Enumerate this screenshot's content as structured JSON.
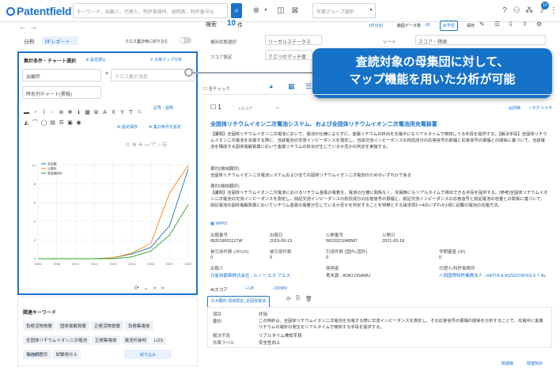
{
  "header": {
    "logo": "Patentfield",
    "search_placeholder": "キーワード、出願人、代理人、特許事務所、発明者、特許番号な",
    "group_placeholder": "作業グループ選択",
    "notification_count": "10"
  },
  "subbar": {
    "analysis_label": "分析",
    "report_button": "PFレポート",
    "cross_filter_label": "クロス集計時に絞り込む",
    "search_label": "検索",
    "result_count": "10",
    "result_unit": "件",
    "view_count": "1件分割",
    "data_count": "範囲データ数",
    "data_value": "60",
    "ai_label": "AI予見",
    "save_label": "保存"
  },
  "left_panel": {
    "section_title": "集計条件・チャート選択",
    "settings_link": "設定読込",
    "map_analysis": "引用マップ分析",
    "field_value": "出願年",
    "cross_placeholder": "クロス集計項目",
    "chart_select": "時系列チャート(累積)",
    "chart_label_link": "記号・説明",
    "save_settings": "設定保存",
    "chart_settings": "集計条件を設定",
    "legend": [
      "全出願",
      "公開件",
      "登録権利件"
    ],
    "more_label": "more »",
    "filter_button": "絞り込み"
  },
  "related_keywords": {
    "title": "関連キーワード",
    "items": [
      "負極活物質層",
      "固体電解質層",
      "正極活物質層",
      "負極集電体",
      "全固体リチウムイオン二次電池",
      "正極集電体",
      "電池外装材",
      "Li2S",
      "電池調整形",
      "試験用セル"
    ]
  },
  "right_panel": {
    "filter_label_1": "権利状態選択",
    "filter_value_1": "リーガルステータス",
    "sort_label": "ソート",
    "sort_value": "スコア・降順",
    "score_label": "スコア設定",
    "score_value": "クエリのマッチ度",
    "all_check": "全チェック",
    "record_index": "1",
    "score_text": "スコア",
    "action_eval": "評価",
    "action_tag": "タグ",
    "action_memo": "メモ",
    "title": "全固体リチウムイオン二次電池システム、および全固体リチウムイオン二次電池用充電装置",
    "abstract": "【課題】全固体リチウムイオン二次電池において、電池の仕様によらずに、金属リチウムの析出を充電中にもリアルタイムで検知しうる手段を提供する。【解決手段】全固体リチウムイオン二次電池を充電する際に、当該電池の交流インピーダンスを測定し、当該交流インピーダンスの抵抗成分の応答信号の振幅と応答信号の振幅との関係に基づいて、当該電池を構成する固体電解質層において金属リチウムの析出が生じているか否かの判定を実施する。",
    "claim_label": "要約(機械翻訳)",
    "claim_text": "全固体リチウムイオン二次電池システムおよび全ての固体リチウムイオン二次電池のためのいずれかである",
    "claim2_label": "要約(機械翻訳)",
    "claim2_text": "【課題】全固体リチウムイオン二次電池におけるリチウム金属の電着を、電池の仕様に関係なく、充電時にもリアルタイムで検出できる手段を提供する。[参考]全固体リチウムイオン二次電池の交流インピーダンスを測定し、前記交流インピーダンスの抵抗成分の応答信号の振幅と、前記交流インピーダンスの応答信号と前記電池の容量との関係に基づいて、前記電池の固体電解質層においてリチウム金属の電着が生じているか否かを判定することを特徴とする請求項1〜4のいずれか1項に記載の電池の充電方法。",
    "office": "WIPO",
    "fields": {
      "app_no_label": "出願番号",
      "app_no": "IB2019001127W",
      "app_date_label": "出願日",
      "app_date": "2019-09-13",
      "pub_no_label": "公開番号",
      "pub_no": "WO2021048587",
      "pub_date_label": "公開日",
      "pub_date": "2021-03-18",
      "cited_label": "被引用件数 (JP/US)",
      "cited": "0",
      "jp_cited_label": "被引用件数",
      "jp_cited": "0",
      "ref_label": "引用件数 (国内+国外)",
      "ref": "0",
      "early_label": "早期審査 (JP)",
      "early": "0",
      "applicant_label": "出願人",
      "applicant": "日産自動車株式会社 , ルノー エス アエス",
      "inventor_label": "発明者",
      "inventor": "青木敦 , AOKI OSAMU",
      "agent_label": "代理人/特許事務所",
      "agent": "八田国際特許業務法人 , HATTA & ASSOCIATES E T AL"
    },
    "ai_score_label": "AIスコア",
    "up_label": "+ UP",
    "down_label": "- DOWN",
    "ai_tab": "AI要約 項目限定_全固体電池",
    "table_head_item": "項目",
    "table_head_eval": "評価",
    "row1_label": "要約",
    "row1_value": "この特許は、全固体リチウムイオン二次電池を充電する際に交流インピーダンスを測定し、その応答信号の振幅の関係を分析することで、充電中に金属リチウムの電析の発生をリアルタイムで検知する手段を提供する。",
    "row2_label": "解決手段",
    "row2_value": "リアルタイム検知手段",
    "row3_label": "効果ラベル",
    "row3_value": "安全性向上",
    "footer_related": "関連株",
    "footer_related2": "関連特許"
  },
  "callout": {
    "line1": "査読対象の母集団に対して、",
    "line2": "マップ機能を用いた分析が可能"
  },
  "chart_data": {
    "type": "line",
    "x": [
      2006,
      2008,
      2010,
      2012,
      2014,
      2016,
      2018,
      2020,
      2022
    ],
    "series": [
      {
        "name": "全出願",
        "values": [
          0,
          0,
          0,
          0,
          0.1,
          0.5,
          1.2,
          3.5,
          9.6
        ]
      },
      {
        "name": "公開件",
        "values": [
          0,
          0,
          0,
          0,
          0.1,
          0.6,
          1.6,
          7.0,
          10.0
        ]
      },
      {
        "name": "登録権利件",
        "values": [
          0,
          0,
          0,
          0,
          0,
          0.2,
          0.8,
          2.5,
          5.8
        ]
      }
    ],
    "xticks": [
      "2006",
      "2008",
      "2010",
      "2012",
      "2014",
      "2016",
      "2018",
      "2020",
      "2022"
    ],
    "yticks": [
      "0",
      "2",
      "4",
      "6",
      "8",
      "10"
    ],
    "ylim": [
      0,
      10.5
    ],
    "colors": [
      "#1f77b4",
      "#ff7f0e",
      "#2ca02c"
    ],
    "grid": true,
    "legend": "top-left"
  }
}
